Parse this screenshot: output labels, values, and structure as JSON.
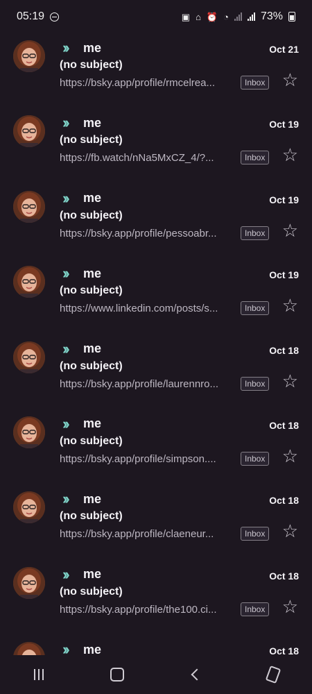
{
  "status_bar": {
    "time": "05:19",
    "battery": "73%"
  },
  "emails": [
    {
      "sender": "me",
      "date": "Oct 21",
      "subject": "(no subject)",
      "snippet": "https://bsky.app/profile/rmcelrea...",
      "label": "Inbox"
    },
    {
      "sender": "me",
      "date": "Oct 19",
      "subject": "(no subject)",
      "snippet": "https://fb.watch/nNa5MxCZ_4/?...",
      "label": "Inbox"
    },
    {
      "sender": "me",
      "date": "Oct 19",
      "subject": "(no subject)",
      "snippet": "https://bsky.app/profile/pessoabr...",
      "label": "Inbox"
    },
    {
      "sender": "me",
      "date": "Oct 19",
      "subject": "(no subject)",
      "snippet": "https://www.linkedin.com/posts/s...",
      "label": "Inbox"
    },
    {
      "sender": "me",
      "date": "Oct 18",
      "subject": "(no subject)",
      "snippet": "https://bsky.app/profile/laurennro...",
      "label": "Inbox"
    },
    {
      "sender": "me",
      "date": "Oct 18",
      "subject": "(no subject)",
      "snippet": "https://bsky.app/profile/simpson....",
      "label": "Inbox"
    },
    {
      "sender": "me",
      "date": "Oct 18",
      "subject": "(no subject)",
      "snippet": "https://bsky.app/profile/claeneur...",
      "label": "Inbox"
    },
    {
      "sender": "me",
      "date": "Oct 18",
      "subject": "(no subject)",
      "snippet": "https://bsky.app/profile/the100.ci...",
      "label": "Inbox"
    },
    {
      "sender": "me",
      "date": "Oct 18"
    }
  ],
  "colors": {
    "background": "#1d1720",
    "forward_icon": "#7fd3c8",
    "text_primary": "#f5f3f7",
    "text_secondary": "#bdb7c2"
  },
  "icons": {
    "forwarded": "forwarded-icon",
    "star": "star-icon",
    "nav": [
      "recents-icon",
      "home-icon",
      "back-icon",
      "rotate-screen-icon"
    ]
  }
}
